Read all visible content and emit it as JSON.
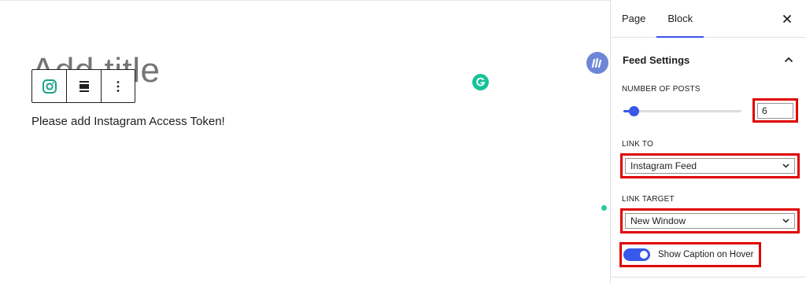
{
  "editor": {
    "title_placeholder": "Add title",
    "notice": "Please add Instagram Access Token!"
  },
  "block_toolbar": {
    "items": [
      {
        "icon": "instagram-icon"
      },
      {
        "icon": "align-icon"
      },
      {
        "icon": "more-options-icon"
      }
    ]
  },
  "sidebar": {
    "tabs": [
      "Page",
      "Block"
    ],
    "active_tab": "Block",
    "panel_title": "Feed Settings",
    "number_of_posts_label": "NUMBER OF POSTS",
    "number_of_posts_value": "6",
    "number_of_posts_slider_fraction": 0.05,
    "link_to_label": "LINK TO",
    "link_to_value": "Instagram Feed",
    "link_target_label": "LINK TARGET",
    "link_target_value": "New Window",
    "show_caption_label": "Show Caption on Hover",
    "show_caption_enabled": true
  },
  "colors": {
    "accent": "#3858e9",
    "highlight": "#e00000",
    "grammarly": "#15c39a"
  }
}
